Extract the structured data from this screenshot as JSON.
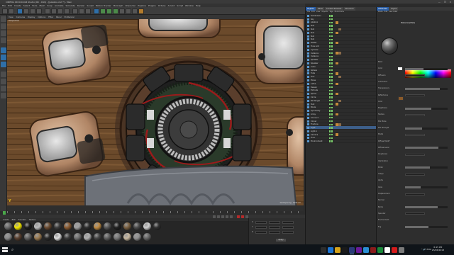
{
  "window": {
    "title": "CINEMA 4D R19.024 Studio (RC - R19) - [Jukebox.c4d *] - Main",
    "controls": "—  ❐  ✕"
  },
  "menubar": [
    "File",
    "Edit",
    "Create",
    "Select",
    "Tools",
    "Mesh",
    "Snap",
    "Animate",
    "Simulate",
    "Render",
    "Sculpt",
    "Motion Tracker",
    "MoGraph",
    "Character",
    "Pipeline",
    "Plugins",
    "Octane",
    "Arnold",
    "Script",
    "Window",
    "Help"
  ],
  "viewport": {
    "menu": [
      "View",
      "Cameras",
      "Display",
      "Options",
      "Filter",
      "Panel",
      "ProRender"
    ],
    "label": "Perspective",
    "grid_spacing": "Grid Spacing : 1000 cm",
    "axis_label": "Y"
  },
  "timeline": {
    "marker": "0"
  },
  "materials": {
    "menu": [
      "Create",
      "Edit",
      "Function",
      "Texture"
    ],
    "swatch_colors": [
      "#6b6b6b",
      "#f2e600",
      "#1b1b1b",
      "#bcbcbc",
      "#6a4a30",
      "#3c3c3c",
      "#8a5a30",
      "#a0a0a0",
      "#2e2e2e",
      "#c08a40",
      "#555555",
      "#202020",
      "#7a6040",
      "#4a4a4a",
      "#d0d0d0",
      "#303030",
      "#8a8a8a",
      "#5a4030",
      "#606060",
      "#9a7a50",
      "#2a2a2a",
      "#e0e0e0",
      "#3a3a3a",
      "#707070",
      "#b0b0b0",
      "#454545",
      "#5e5e5e",
      "#787878",
      "#c8b8a0",
      "#909090",
      "#666666"
    ]
  },
  "coordinates": {
    "rows": [
      {
        "axis": "X",
        "pos": "0 cm",
        "size": "0 cm",
        "rot": "0 °"
      },
      {
        "axis": "Y",
        "pos": "0 cm",
        "size": "0 cm",
        "rot": "0 °"
      },
      {
        "axis": "Z",
        "pos": "0 cm",
        "size": "0 cm",
        "rot": "0 °"
      }
    ],
    "apply": "Apply"
  },
  "object_manager": {
    "tabs": [
      "Objects",
      "Takes",
      "Content Browser",
      "Structure"
    ],
    "menu": [
      "File",
      "Edit",
      "View",
      "Objects",
      "Tags",
      "Bookmarks"
    ],
    "objects": [
      "Subdivision",
      "Sky",
      "Jukebox",
      "Null",
      "Null",
      "Null",
      "Null",
      "Null",
      "Platter",
      "Tone Arm",
      "Cylinder",
      "Instance",
      "Instance",
      "Speaker",
      "Speaker",
      "Cube",
      "Sphere",
      "Tube",
      "Disc",
      "Plane",
      "Lathe",
      "Sweep",
      "Extrude",
      "Spline",
      "Circle",
      "Rectangle",
      "Text",
      "Boole",
      "Symmetry",
      "Array",
      "Connect",
      "Cloner",
      "Fracture",
      "Light",
      "Light.1",
      "Camera",
      "Floor",
      "Environment"
    ]
  },
  "attribute_manager": {
    "tabs": [
      "Attributes",
      "Layers"
    ],
    "menu": [
      "Mode",
      "Edit",
      "User Data"
    ],
    "material_name": "Material [Mat]",
    "rows": [
      "Basic",
      "Color",
      "Diffusion",
      "Luminance",
      "Transparency",
      "Reflectance",
      "Color",
      "Brightness",
      "Texture",
      "Mix Mode",
      "Mix Strength",
      "Model",
      "Diffuse Falloff",
      "Diffuse Level",
      "Roughness",
      "Illumination",
      "Editor",
      "Assign",
      "Alpha",
      "Glow",
      "Displacement",
      "Normal",
      "Bump",
      "Specular",
      "Environment",
      "Fog"
    ]
  },
  "taskbar": {
    "search": "⌕",
    "apps": [
      {
        "color": "#2d2d2d"
      },
      {
        "color": "#1b74d4"
      },
      {
        "color": "#d4a21b"
      },
      {
        "color": "#1a1a1a"
      },
      {
        "color": "#2a3a7a"
      },
      {
        "color": "#6a1b9a"
      },
      {
        "color": "#2a8fd4"
      },
      {
        "color": "#8a1b1b"
      },
      {
        "color": "#1b8a3a"
      },
      {
        "color": "#ffffff"
      },
      {
        "color": "#d41b1b"
      },
      {
        "color": "#7a7a7a"
      }
    ],
    "tray": "^  🔊  ENG",
    "time": "8:45 PM",
    "date": "23/06/2018"
  }
}
